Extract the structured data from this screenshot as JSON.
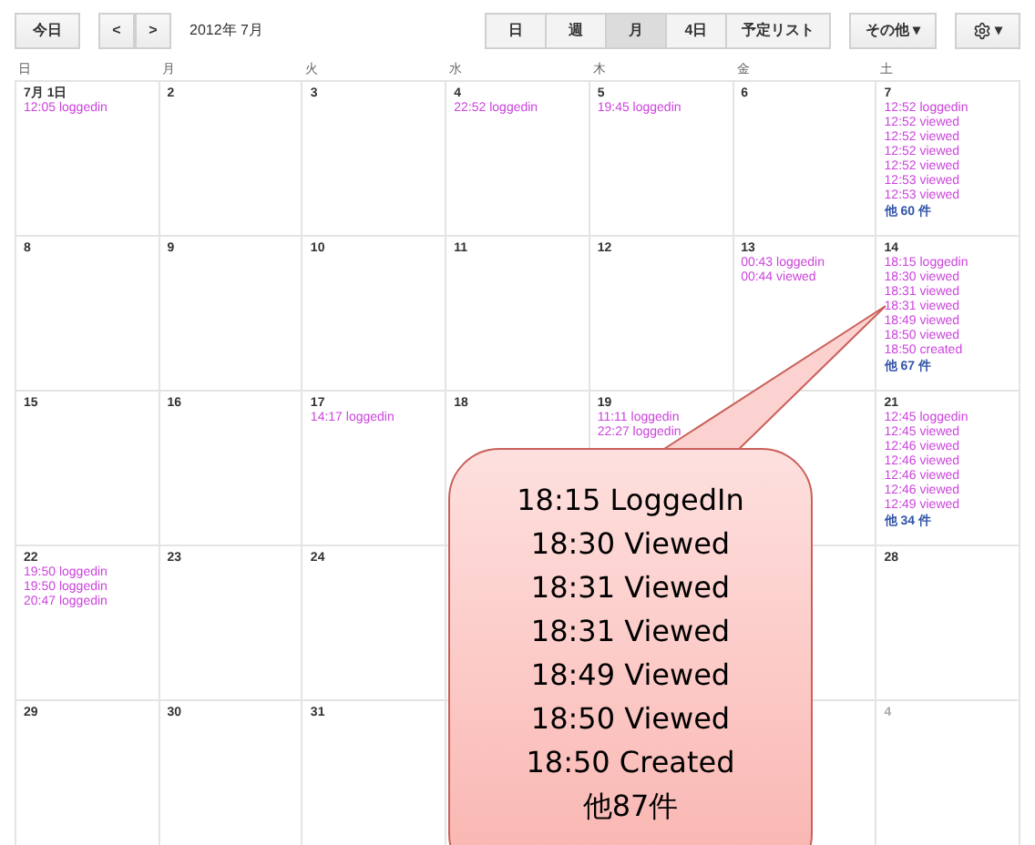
{
  "toolbar": {
    "today": "今日",
    "prev": "<",
    "next": ">",
    "month_title": "2012年 7月",
    "views": [
      {
        "label": "日",
        "selected": false
      },
      {
        "label": "週",
        "selected": false
      },
      {
        "label": "月",
        "selected": true
      },
      {
        "label": "4日",
        "selected": false
      },
      {
        "label": "予定リスト",
        "selected": false
      }
    ],
    "more_menu": "その他",
    "more_caret": "▾",
    "settings_caret": "▾"
  },
  "weekdays": [
    "日",
    "月",
    "火",
    "水",
    "木",
    "金",
    "土"
  ],
  "weeks": [
    [
      {
        "kind": "day",
        "date": "7月 1日",
        "events": [
          "12:05 loggedin"
        ]
      },
      {
        "kind": "day",
        "date": "2"
      },
      {
        "kind": "day",
        "date": "3"
      },
      {
        "kind": "day",
        "date": "4",
        "events": [
          "22:52 loggedin"
        ]
      },
      {
        "kind": "day",
        "date": "5",
        "events": [
          "19:45 loggedin"
        ]
      },
      {
        "kind": "day",
        "date": "6"
      },
      {
        "kind": "day",
        "date": "7",
        "events": [
          "12:52 loggedin",
          "12:52 viewed",
          "12:52 viewed",
          "12:52 viewed",
          "12:52 viewed",
          "12:53 viewed",
          "12:53 viewed"
        ],
        "more": "他 60 件"
      }
    ],
    [
      {
        "kind": "day",
        "date": "8"
      },
      {
        "kind": "day",
        "date": "9"
      },
      {
        "kind": "day",
        "date": "10"
      },
      {
        "kind": "day",
        "date": "11"
      },
      {
        "kind": "day",
        "date": "12"
      },
      {
        "kind": "day",
        "date": "13",
        "events": [
          "00:43 loggedin",
          "00:44 viewed"
        ]
      },
      {
        "kind": "day",
        "date": "14",
        "events": [
          "18:15 loggedin",
          "18:30 viewed",
          "18:31 viewed",
          "18:31 viewed",
          "18:49 viewed",
          "18:50 viewed",
          "18:50 created"
        ],
        "more": "他 67 件"
      }
    ],
    [
      {
        "kind": "day",
        "date": "15"
      },
      {
        "kind": "day",
        "date": "16"
      },
      {
        "kind": "day",
        "date": "17",
        "events": [
          "14:17 loggedin"
        ]
      },
      {
        "kind": "day",
        "date": "18"
      },
      {
        "kind": "day",
        "date": "19",
        "events": [
          "11:11 loggedin",
          "22:27 loggedin"
        ]
      },
      {
        "kind": "covered"
      },
      {
        "kind": "day",
        "date": "21",
        "events": [
          "12:45 loggedin",
          "12:45 viewed",
          "12:46 viewed",
          "12:46 viewed",
          "12:46 viewed",
          "12:46 viewed",
          "12:49 viewed"
        ],
        "more": "他 34 件"
      }
    ],
    [
      {
        "kind": "day",
        "date": "22",
        "events": [
          "19:50 loggedin",
          "19:50 loggedin",
          "20:47 loggedin"
        ]
      },
      {
        "kind": "day",
        "date": "23"
      },
      {
        "kind": "day",
        "date": "24"
      },
      {
        "kind": "covered"
      },
      {
        "kind": "hidden"
      },
      {
        "kind": "covered"
      },
      {
        "kind": "day",
        "date": "28"
      }
    ],
    [
      {
        "kind": "day",
        "date": "29"
      },
      {
        "kind": "day",
        "date": "30"
      },
      {
        "kind": "day",
        "date": "31"
      },
      {
        "kind": "hidden"
      },
      {
        "kind": "hidden"
      },
      {
        "kind": "covered"
      },
      {
        "kind": "day",
        "date": "4",
        "other_month": true
      }
    ]
  ],
  "callout": {
    "lines": [
      "18:15 LoggedIn",
      "18:30 Viewed",
      "18:31 Viewed",
      "18:31 Viewed",
      "18:49 Viewed",
      "18:50 Viewed",
      "18:50 Created",
      "他87件"
    ]
  }
}
